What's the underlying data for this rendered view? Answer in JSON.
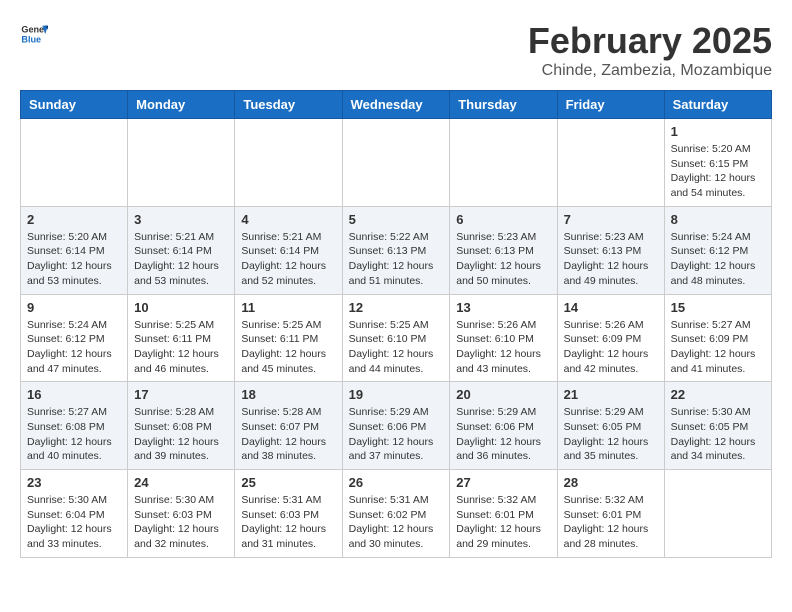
{
  "header": {
    "logo": "GeneralBlue",
    "month": "February 2025",
    "location": "Chinde, Zambezia, Mozambique"
  },
  "days_of_week": [
    "Sunday",
    "Monday",
    "Tuesday",
    "Wednesday",
    "Thursday",
    "Friday",
    "Saturday"
  ],
  "weeks": [
    [
      {
        "day": "",
        "info": ""
      },
      {
        "day": "",
        "info": ""
      },
      {
        "day": "",
        "info": ""
      },
      {
        "day": "",
        "info": ""
      },
      {
        "day": "",
        "info": ""
      },
      {
        "day": "",
        "info": ""
      },
      {
        "day": "1",
        "info": "Sunrise: 5:20 AM\nSunset: 6:15 PM\nDaylight: 12 hours\nand 54 minutes."
      }
    ],
    [
      {
        "day": "2",
        "info": "Sunrise: 5:20 AM\nSunset: 6:14 PM\nDaylight: 12 hours\nand 53 minutes."
      },
      {
        "day": "3",
        "info": "Sunrise: 5:21 AM\nSunset: 6:14 PM\nDaylight: 12 hours\nand 53 minutes."
      },
      {
        "day": "4",
        "info": "Sunrise: 5:21 AM\nSunset: 6:14 PM\nDaylight: 12 hours\nand 52 minutes."
      },
      {
        "day": "5",
        "info": "Sunrise: 5:22 AM\nSunset: 6:13 PM\nDaylight: 12 hours\nand 51 minutes."
      },
      {
        "day": "6",
        "info": "Sunrise: 5:23 AM\nSunset: 6:13 PM\nDaylight: 12 hours\nand 50 minutes."
      },
      {
        "day": "7",
        "info": "Sunrise: 5:23 AM\nSunset: 6:13 PM\nDaylight: 12 hours\nand 49 minutes."
      },
      {
        "day": "8",
        "info": "Sunrise: 5:24 AM\nSunset: 6:12 PM\nDaylight: 12 hours\nand 48 minutes."
      }
    ],
    [
      {
        "day": "9",
        "info": "Sunrise: 5:24 AM\nSunset: 6:12 PM\nDaylight: 12 hours\nand 47 minutes."
      },
      {
        "day": "10",
        "info": "Sunrise: 5:25 AM\nSunset: 6:11 PM\nDaylight: 12 hours\nand 46 minutes."
      },
      {
        "day": "11",
        "info": "Sunrise: 5:25 AM\nSunset: 6:11 PM\nDaylight: 12 hours\nand 45 minutes."
      },
      {
        "day": "12",
        "info": "Sunrise: 5:25 AM\nSunset: 6:10 PM\nDaylight: 12 hours\nand 44 minutes."
      },
      {
        "day": "13",
        "info": "Sunrise: 5:26 AM\nSunset: 6:10 PM\nDaylight: 12 hours\nand 43 minutes."
      },
      {
        "day": "14",
        "info": "Sunrise: 5:26 AM\nSunset: 6:09 PM\nDaylight: 12 hours\nand 42 minutes."
      },
      {
        "day": "15",
        "info": "Sunrise: 5:27 AM\nSunset: 6:09 PM\nDaylight: 12 hours\nand 41 minutes."
      }
    ],
    [
      {
        "day": "16",
        "info": "Sunrise: 5:27 AM\nSunset: 6:08 PM\nDaylight: 12 hours\nand 40 minutes."
      },
      {
        "day": "17",
        "info": "Sunrise: 5:28 AM\nSunset: 6:08 PM\nDaylight: 12 hours\nand 39 minutes."
      },
      {
        "day": "18",
        "info": "Sunrise: 5:28 AM\nSunset: 6:07 PM\nDaylight: 12 hours\nand 38 minutes."
      },
      {
        "day": "19",
        "info": "Sunrise: 5:29 AM\nSunset: 6:06 PM\nDaylight: 12 hours\nand 37 minutes."
      },
      {
        "day": "20",
        "info": "Sunrise: 5:29 AM\nSunset: 6:06 PM\nDaylight: 12 hours\nand 36 minutes."
      },
      {
        "day": "21",
        "info": "Sunrise: 5:29 AM\nSunset: 6:05 PM\nDaylight: 12 hours\nand 35 minutes."
      },
      {
        "day": "22",
        "info": "Sunrise: 5:30 AM\nSunset: 6:05 PM\nDaylight: 12 hours\nand 34 minutes."
      }
    ],
    [
      {
        "day": "23",
        "info": "Sunrise: 5:30 AM\nSunset: 6:04 PM\nDaylight: 12 hours\nand 33 minutes."
      },
      {
        "day": "24",
        "info": "Sunrise: 5:30 AM\nSunset: 6:03 PM\nDaylight: 12 hours\nand 32 minutes."
      },
      {
        "day": "25",
        "info": "Sunrise: 5:31 AM\nSunset: 6:03 PM\nDaylight: 12 hours\nand 31 minutes."
      },
      {
        "day": "26",
        "info": "Sunrise: 5:31 AM\nSunset: 6:02 PM\nDaylight: 12 hours\nand 30 minutes."
      },
      {
        "day": "27",
        "info": "Sunrise: 5:32 AM\nSunset: 6:01 PM\nDaylight: 12 hours\nand 29 minutes."
      },
      {
        "day": "28",
        "info": "Sunrise: 5:32 AM\nSunset: 6:01 PM\nDaylight: 12 hours\nand 28 minutes."
      },
      {
        "day": "",
        "info": ""
      }
    ]
  ]
}
